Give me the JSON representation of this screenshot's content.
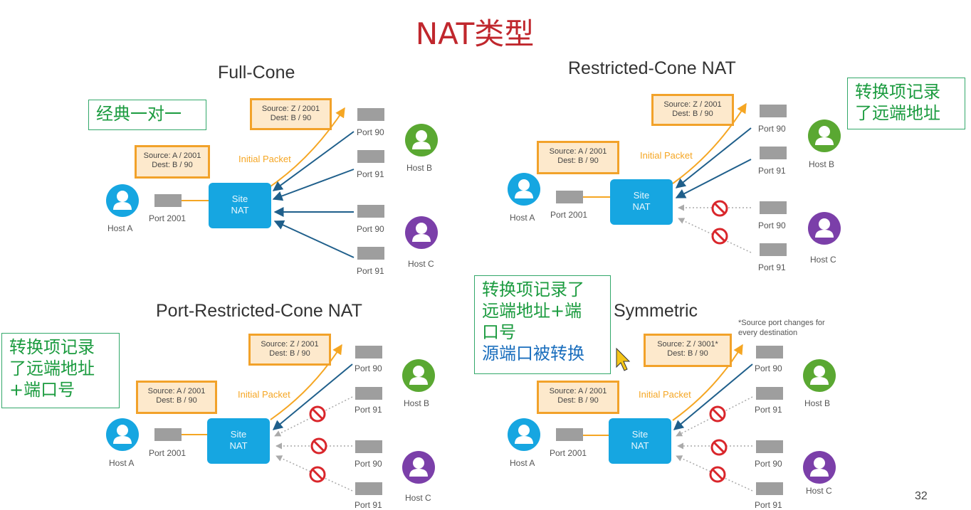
{
  "title": "NAT类型",
  "page_number": "32",
  "colors": {
    "title": "#c0272d",
    "nat": "#16a6e1",
    "packet_border": "#f2a22a",
    "arrow_blue": "#1f5f8b",
    "arrow_orange": "#f5a623",
    "blocked": "#d9262b",
    "host_a": "#16a6e1",
    "host_b": "#5aa832",
    "host_c": "#7b3fa9",
    "note_green": "#1b9b3f",
    "note_blue": "#1a6ebd"
  },
  "labels": {
    "host_a": "Host A",
    "host_b": "Host B",
    "host_c": "Host C",
    "port_2001": "Port 2001",
    "port_90": "Port 90",
    "port_91": "Port 91",
    "site": "Site",
    "nat": "NAT",
    "initial_packet": "Initial Packet"
  },
  "quadrants": {
    "full_cone": {
      "title": "Full-Cone",
      "note": [
        "经典一对一"
      ],
      "packet_in": [
        "Source: A / 2001",
        "Dest: B / 90"
      ],
      "packet_out": [
        "Source: Z / 2001",
        "Dest: B / 90"
      ]
    },
    "restricted_cone": {
      "title": "Restricted-Cone NAT",
      "note": [
        "转换项记录",
        "了远端地址"
      ],
      "packet_in": [
        "Source: A / 2001",
        "Dest: B / 90"
      ],
      "packet_out": [
        "Source: Z / 2001",
        "Dest: B / 90"
      ]
    },
    "port_restricted": {
      "title": "Port-Restricted-Cone NAT",
      "note": [
        "转换项记录",
        "了远端地址",
        "+端口号"
      ],
      "packet_in": [
        "Source: A / 2001",
        "Dest: B / 90"
      ],
      "packet_out": [
        "Source: Z / 2001",
        "Dest: B / 90"
      ]
    },
    "symmetric": {
      "title": "Symmetric",
      "note": [
        "转换项记录了",
        "远端地址+端",
        "口号",
        "源端口被转换"
      ],
      "source_port_note": [
        "*Source port changes for",
        "every destination"
      ],
      "packet_in": [
        "Source: A / 2001",
        "Dest: B / 90"
      ],
      "packet_out": [
        "Source: Z / 3001*",
        "Dest: B / 90"
      ]
    }
  }
}
